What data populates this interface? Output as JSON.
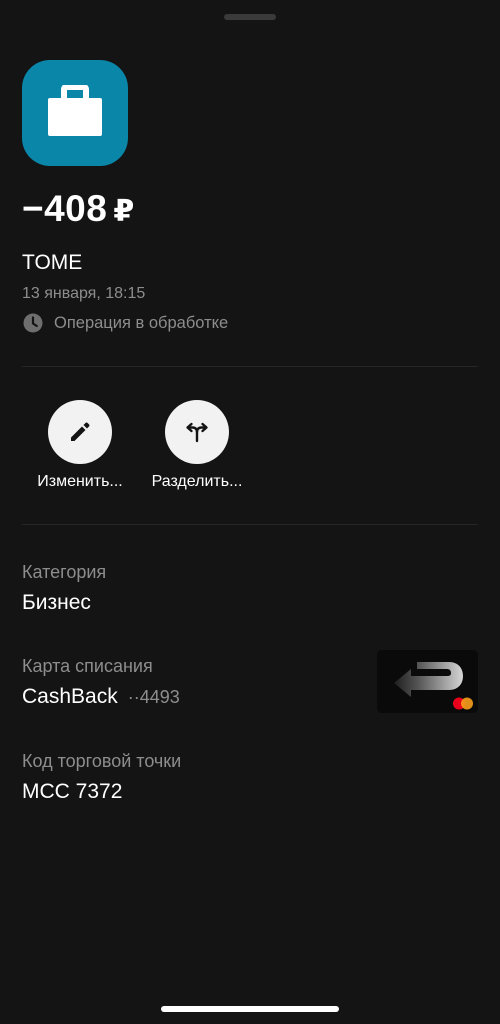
{
  "transaction": {
    "amount": "−408",
    "currency": "₽",
    "merchant": "TOME",
    "datetime": "13 января, 18:15",
    "status": "Операция в обработке",
    "icon": "briefcase-icon",
    "icon_bg_color": "#0a86a8"
  },
  "actions": [
    {
      "label": "Изменить...",
      "icon": "pencil-icon"
    },
    {
      "label": "Разделить...",
      "icon": "split-arrows-icon"
    }
  ],
  "details": {
    "category": {
      "label": "Категория",
      "value": "Бизнес"
    },
    "card": {
      "label": "Карта списания",
      "name": "CashBack",
      "mask": "··4493",
      "network": "mastercard-icon"
    },
    "mcc": {
      "label": "Код торговой точки",
      "value": "MCC 7372"
    }
  }
}
